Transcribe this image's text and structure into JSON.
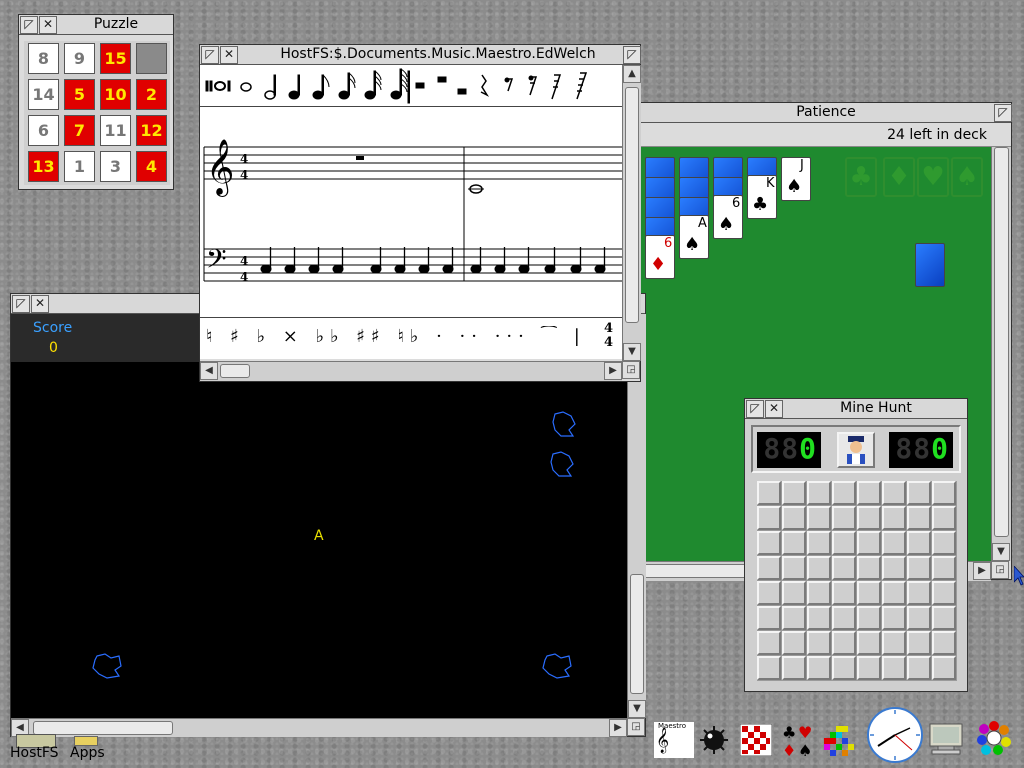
{
  "puzzle": {
    "title": "Puzzle",
    "tiles": [
      {
        "label": "8",
        "style": "w"
      },
      {
        "label": "9",
        "style": "w"
      },
      {
        "label": "15",
        "style": "r"
      },
      {
        "label": "",
        "style": "e"
      },
      {
        "label": "14",
        "style": "w"
      },
      {
        "label": "5",
        "style": "r"
      },
      {
        "label": "10",
        "style": "r"
      },
      {
        "label": "2",
        "style": "r"
      },
      {
        "label": "6",
        "style": "w"
      },
      {
        "label": "7",
        "style": "r"
      },
      {
        "label": "11",
        "style": "w"
      },
      {
        "label": "12",
        "style": "r"
      },
      {
        "label": "13",
        "style": "r"
      },
      {
        "label": "1",
        "style": "w"
      },
      {
        "label": "3",
        "style": "w"
      },
      {
        "label": "4",
        "style": "r"
      }
    ]
  },
  "maestro": {
    "title": "HostFS:$.Documents.Music.Maestro.EdWelch",
    "time_signature": "4\n4",
    "toolbar_symbols": "♮ ♯ ♭ × ♭♭ ♯♯ ♮♭ · ·· ··· ⁀ | 𝄞 𝄢"
  },
  "patience": {
    "title": "Patience",
    "status": "24 left in deck",
    "cards": [
      {
        "rank": "6",
        "suit": "♦",
        "color": "#d00000"
      },
      {
        "rank": "A",
        "suit": "♠",
        "color": "#000000"
      },
      {
        "rank": "6",
        "suit": "♠",
        "color": "#000000"
      },
      {
        "rank": "K",
        "suit": "♣",
        "color": "#000000"
      },
      {
        "rank": "J",
        "suit": "♠",
        "color": "#000000"
      }
    ],
    "foundation_suits": [
      "♣",
      "♦",
      "♥",
      "♠"
    ]
  },
  "asteroids": {
    "score_label": "Score",
    "score_value": "0",
    "ship": "A"
  },
  "minehunt": {
    "title": "Mine Hunt",
    "left_counter": "0",
    "right_counter": "0",
    "dim_digits": "88",
    "grid_cols": 8,
    "grid_rows": 8
  },
  "iconbar": {
    "hostfs_label": "HostFS",
    "apps_label": "Apps",
    "maestro_icon_label": "Maestro"
  },
  "colors": {
    "felt": "#1f8a2f",
    "game_bg": "#000000",
    "score_text": "#3aa0ff",
    "score_value": "#ffe000",
    "asteroid": "#2a6dff"
  }
}
